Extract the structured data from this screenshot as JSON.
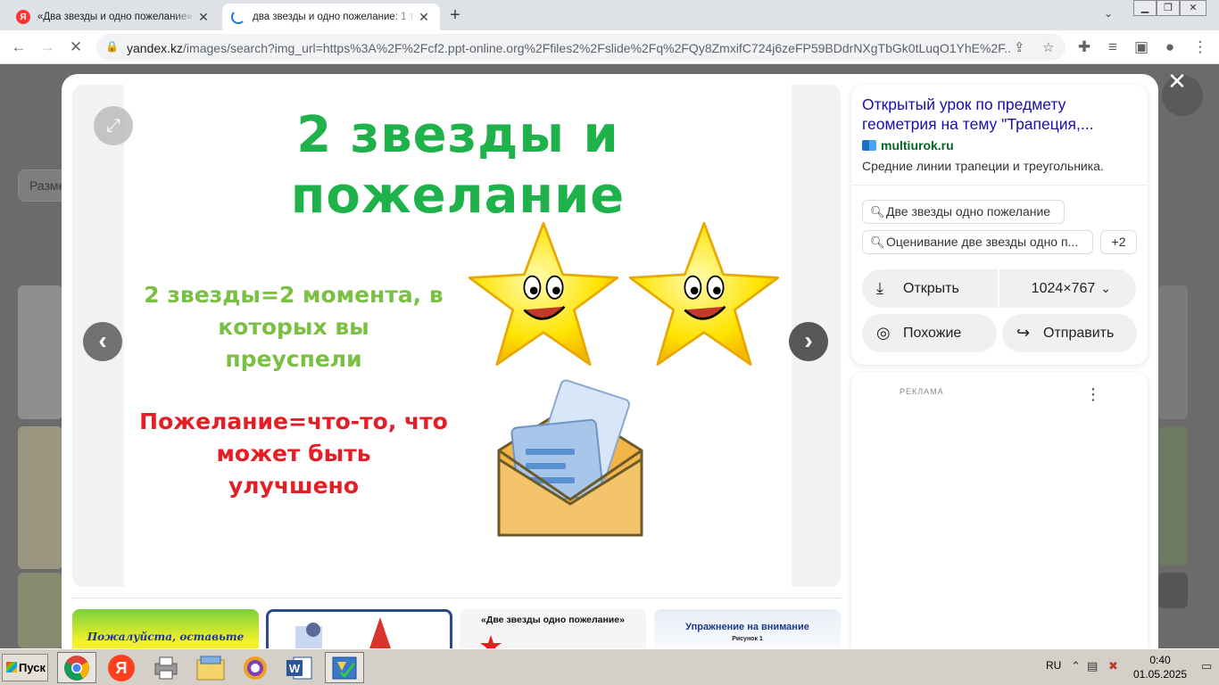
{
  "browser": {
    "tabs": [
      {
        "title": "«Два звезды и одно пожелание» - ...",
        "active": false
      },
      {
        "title": "два звезды и одно пожелание: 1 т",
        "active": true
      }
    ],
    "url_host": "yandex.kz",
    "url_rest": "/images/search?img_url=https%3A%2F%2Fcf2.ppt-online.org%2Ffiles2%2Fslide%2Fq%2FQy8ZmxifC724j6zeFP59BDdrNXgTbGk0tLuqO1YhE%2F..."
  },
  "background_page": {
    "size_chip": "Разме"
  },
  "slide": {
    "title_line1": "2 звезды и",
    "title_line2": "пожелание",
    "green_line1": "2 звезды=2 момента, в",
    "green_line2": "которых вы",
    "green_line3": "преуспели",
    "red_line1": "Пожелание=что-то, что",
    "red_line2": "может быть",
    "red_line3": "улучшено"
  },
  "thumbnails": [
    {
      "caption": "Пожалуйста, оставьте"
    },
    {
      "caption": ""
    },
    {
      "caption": "«Две звезды одно пожелание»"
    },
    {
      "caption": "Упражнение на внимание",
      "sub": "Рисунок 1"
    }
  ],
  "info": {
    "title": "Открытый урок по предмету геометрия на тему \"Трапеция,...",
    "source": "multiurok.ru",
    "description": "Средние линии трапеции и треугольника.",
    "chips": [
      "Две звезды одно пожелание",
      "Оценивание две звезды одно п..."
    ],
    "more_chips": "+2",
    "open_label": "Открыть",
    "size_label": "1024×767",
    "similar_label": "Похожие",
    "share_label": "Отправить"
  },
  "ad": {
    "label": "РЕКЛАМА"
  },
  "taskbar": {
    "start_label": "Пуск",
    "lang": "RU",
    "time": "0:40",
    "date": "01.05.2025"
  },
  "colors": {
    "title_green": "#1fb24a",
    "text_lightgreen": "#7ac043",
    "text_red": "#e41e25",
    "link_blue": "#1a0dab",
    "source_green": "#006621"
  }
}
